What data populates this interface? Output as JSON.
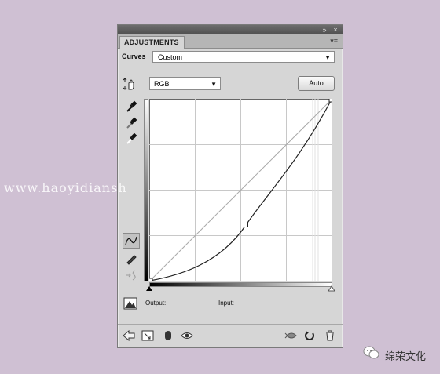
{
  "panel": {
    "tab_title": "ADJUSTMENTS",
    "curves_label": "Curves",
    "preset_value": "Custom",
    "channel_value": "RGB",
    "auto_label": "Auto",
    "output_label": "Output:",
    "input_label": "Input:"
  },
  "curve": {
    "description_points": [
      [
        0,
        0
      ],
      [
        107,
        67
      ],
      [
        255,
        255
      ]
    ]
  },
  "icons": {
    "tool_hand": "hand-adjust-icon",
    "eyedropper_black": "eyedropper-black-icon",
    "eyedropper_gray": "eyedropper-gray-icon",
    "eyedropper_white": "eyedropper-white-icon",
    "curve_point": "curve-point-tool-icon",
    "pencil": "pencil-draw-icon",
    "smooth": "smooth-curve-icon",
    "clipping": "clipping-warning-icon",
    "back": "back-arrow-icon",
    "expand": "expand-view-icon",
    "clip_layer": "clip-to-layer-icon",
    "visibility": "eye-visibility-icon",
    "previous_state": "view-previous-icon",
    "reset": "reset-icon",
    "delete": "trash-icon"
  },
  "watermark": "www.haoyidiansh",
  "brand": "绵荣文化",
  "colors": {
    "background": "#cfc0d3",
    "panel": "#d6d6d6"
  }
}
